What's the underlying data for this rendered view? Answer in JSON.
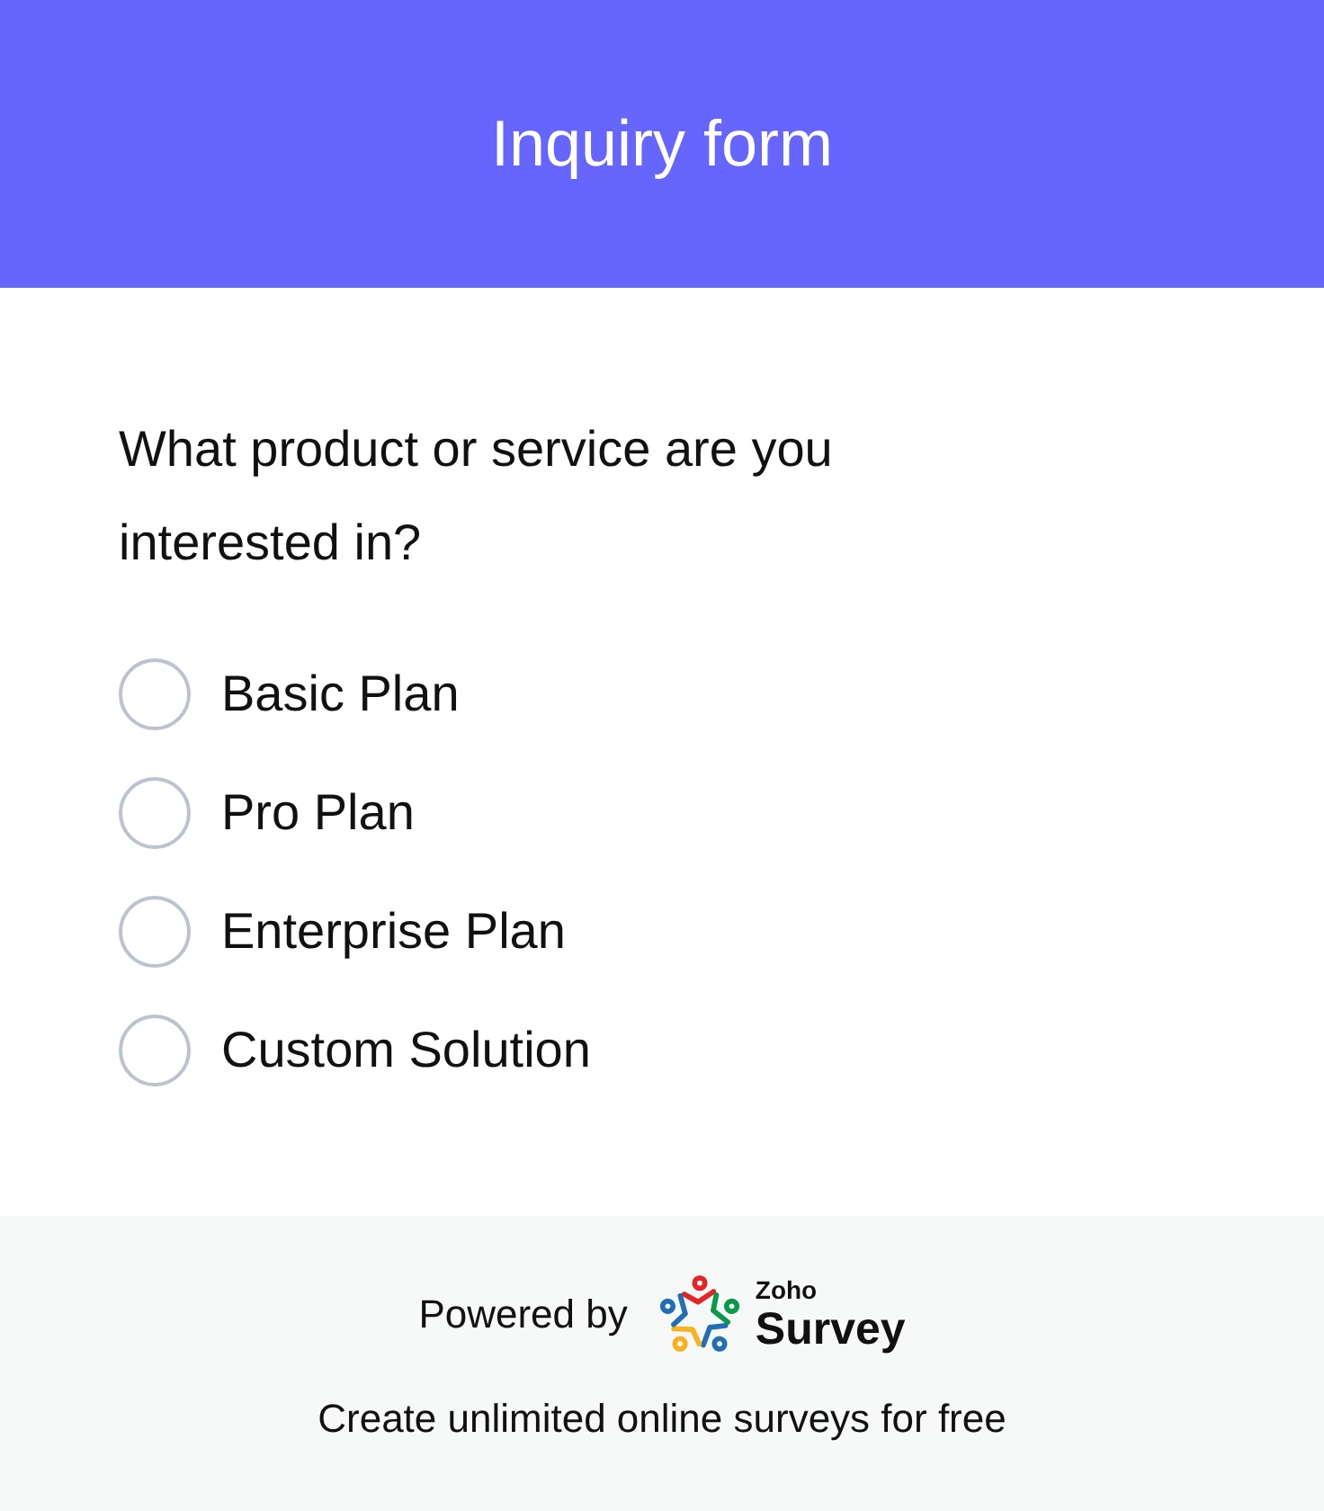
{
  "header": {
    "title": "Inquiry form"
  },
  "question": {
    "text": "What product or service are you interested in?",
    "options": [
      {
        "label": "Basic Plan",
        "selected": false
      },
      {
        "label": "Pro Plan",
        "selected": false
      },
      {
        "label": "Enterprise Plan",
        "selected": false
      },
      {
        "label": "Custom Solution",
        "selected": false
      }
    ]
  },
  "footer": {
    "powered_by": "Powered by",
    "logo": {
      "brand": "Zoho",
      "product": "Survey"
    },
    "tagline": "Create unlimited online surveys for free"
  }
}
